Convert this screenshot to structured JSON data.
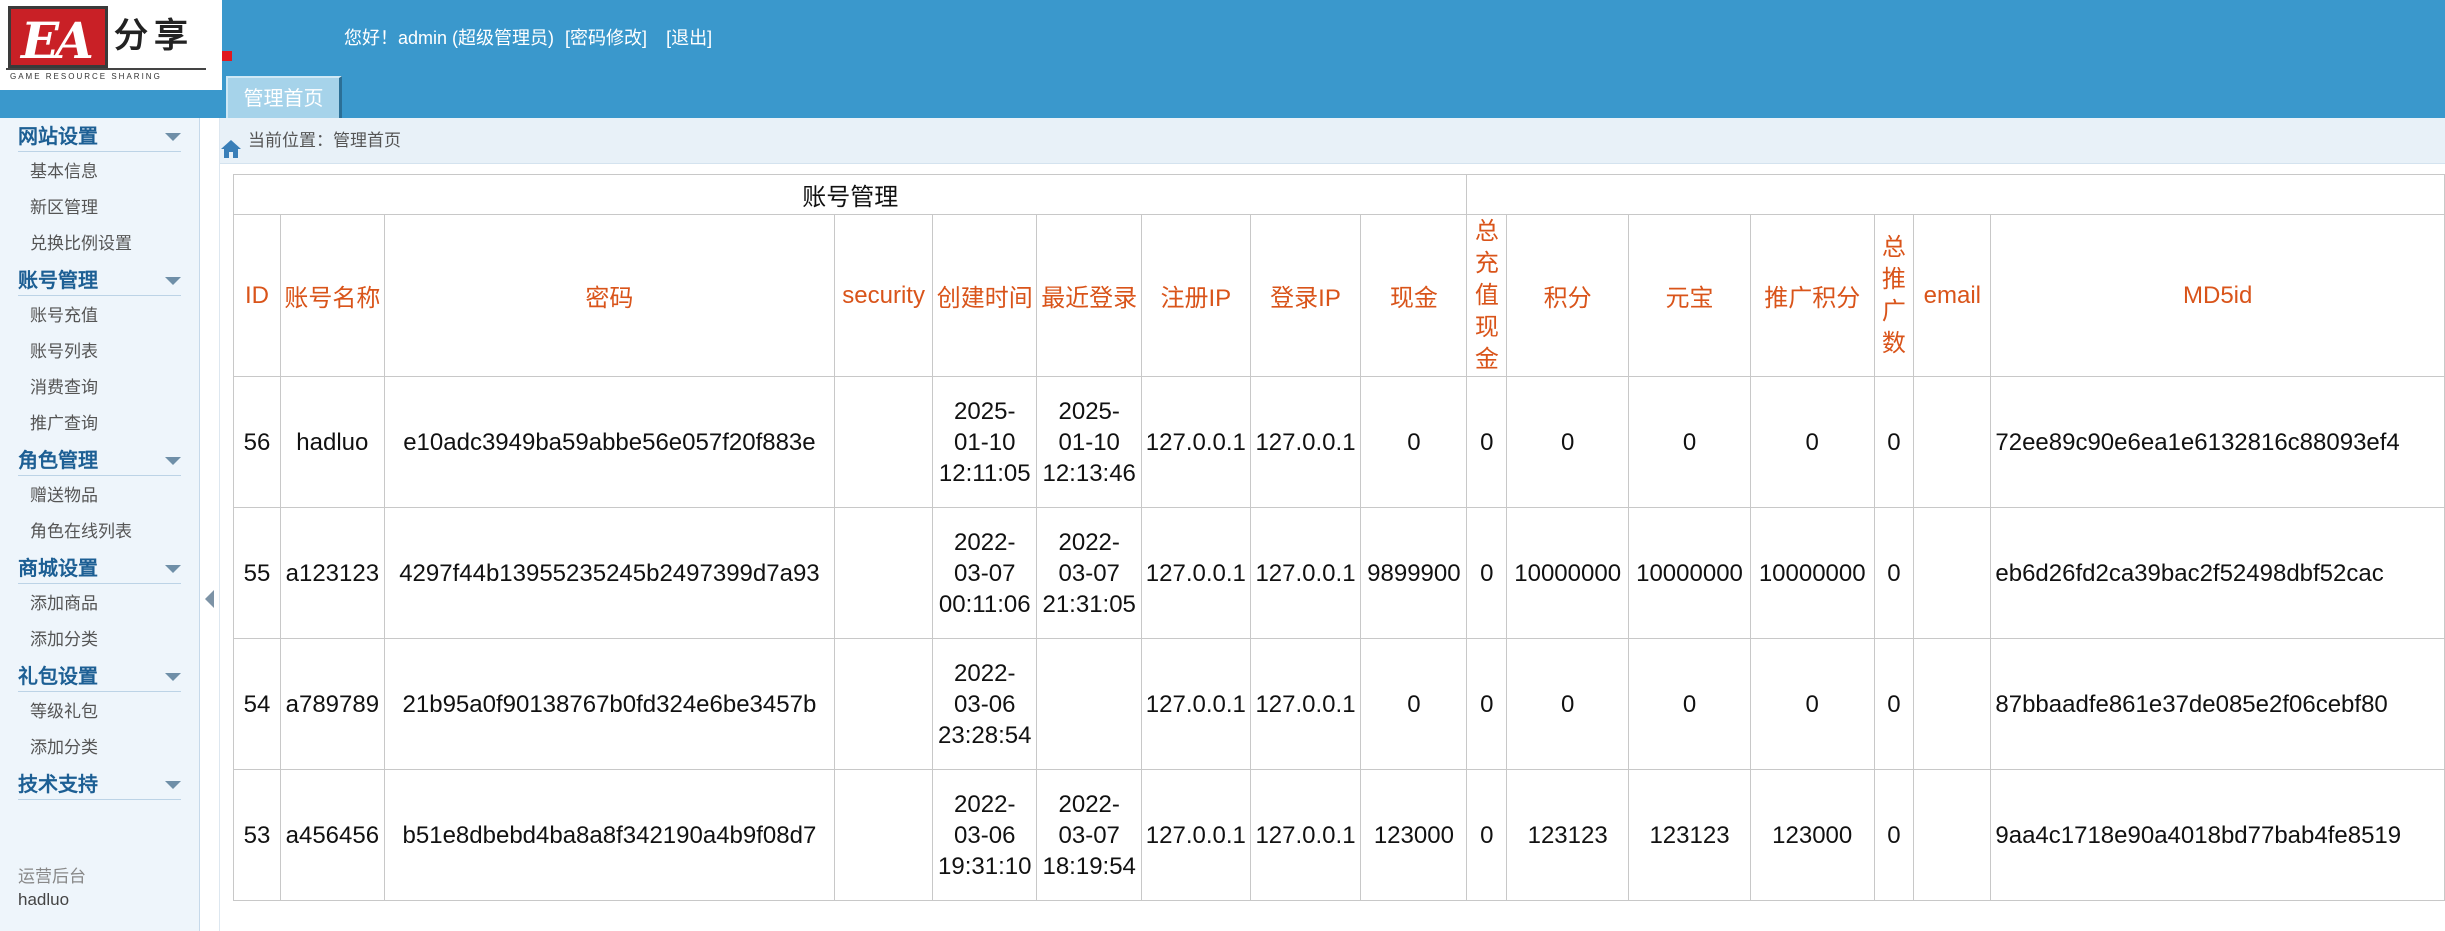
{
  "header": {
    "logo_brand": "分享",
    "logo_tagline": "GAME RESOURCE SHARING",
    "welcome": "您好！admin (超级管理员)",
    "change_password": "[密码修改]",
    "logout": "[退出]",
    "home_tab": "管理首页",
    "accent_color": "#3a98cc"
  },
  "sidebar": {
    "groups": [
      {
        "title": "网站设置",
        "items": [
          "基本信息",
          "新区管理",
          "兑换比例设置"
        ]
      },
      {
        "title": "账号管理",
        "items": [
          "账号充值",
          "账号列表",
          "消费查询",
          "推广查询"
        ]
      },
      {
        "title": "角色管理",
        "items": [
          "赠送物品",
          "角色在线列表"
        ]
      },
      {
        "title": "商城设置",
        "items": [
          "添加商品",
          "添加分类"
        ]
      },
      {
        "title": "礼包设置",
        "items": [
          "等级礼包",
          "添加分类"
        ]
      },
      {
        "title": "技术支持",
        "items": []
      }
    ],
    "extra1": "运营后台",
    "extra2": "hadluo"
  },
  "breadcrumb": {
    "text": "当前位置：管理首页",
    "icon": "home-icon"
  },
  "table": {
    "caption": "账号管理",
    "columns": [
      "ID",
      "账号名称",
      "密码",
      "security",
      "创建时间",
      "最近登录",
      "注册IP",
      "登录IP",
      "现金",
      "总充值现金",
      "积分",
      "元宝",
      "推广积分",
      "总推广数",
      "email",
      "MD5id"
    ],
    "header_color": "#d9541a",
    "rows": [
      {
        "id": "56",
        "name": "hadluo",
        "password": "e10adc3949ba59abbe56e057f20f883e",
        "security": "",
        "created": [
          "2025-",
          "01-10",
          "12:11:05"
        ],
        "last_login": [
          "2025-",
          "01-10",
          "12:13:46"
        ],
        "reg_ip": "127.0.0.1",
        "login_ip": "127.0.0.1",
        "cash": "0",
        "total_recharge": "0",
        "points": "0",
        "yuanbao": "0",
        "promo_points": "0",
        "promo_count": "0",
        "email": "",
        "md5id": "72ee89c90e6ea1e6132816c88093ef4"
      },
      {
        "id": "55",
        "name": "a123123",
        "password": "4297f44b13955235245b2497399d7a93",
        "security": "",
        "created": [
          "2022-",
          "03-07",
          "00:11:06"
        ],
        "last_login": [
          "2022-",
          "03-07",
          "21:31:05"
        ],
        "reg_ip": "127.0.0.1",
        "login_ip": "127.0.0.1",
        "cash": "9899900",
        "total_recharge": "0",
        "points": "10000000",
        "yuanbao": "10000000",
        "promo_points": "10000000",
        "promo_count": "0",
        "email": "",
        "md5id": "eb6d26fd2ca39bac2f52498dbf52cac"
      },
      {
        "id": "54",
        "name": "a789789",
        "password": "21b95a0f90138767b0fd324e6be3457b",
        "security": "",
        "created": [
          "2022-",
          "03-06",
          "23:28:54"
        ],
        "last_login": [
          "",
          "",
          ""
        ],
        "reg_ip": "127.0.0.1",
        "login_ip": "127.0.0.1",
        "cash": "0",
        "total_recharge": "0",
        "points": "0",
        "yuanbao": "0",
        "promo_points": "0",
        "promo_count": "0",
        "email": "",
        "md5id": "87bbaadfe861e37de085e2f06cebf80"
      },
      {
        "id": "53",
        "name": "a456456",
        "password": "b51e8dbebd4ba8a8f342190a4b9f08d7",
        "security": "",
        "created": [
          "2022-",
          "03-06",
          "19:31:10"
        ],
        "last_login": [
          "2022-",
          "03-07",
          "18:19:54"
        ],
        "reg_ip": "127.0.0.1",
        "login_ip": "127.0.0.1",
        "cash": "123000",
        "total_recharge": "0",
        "points": "123123",
        "yuanbao": "123123",
        "promo_points": "123000",
        "promo_count": "0",
        "email": "",
        "md5id": "9aa4c1718e90a4018bd77bab4fe8519"
      }
    ]
  }
}
